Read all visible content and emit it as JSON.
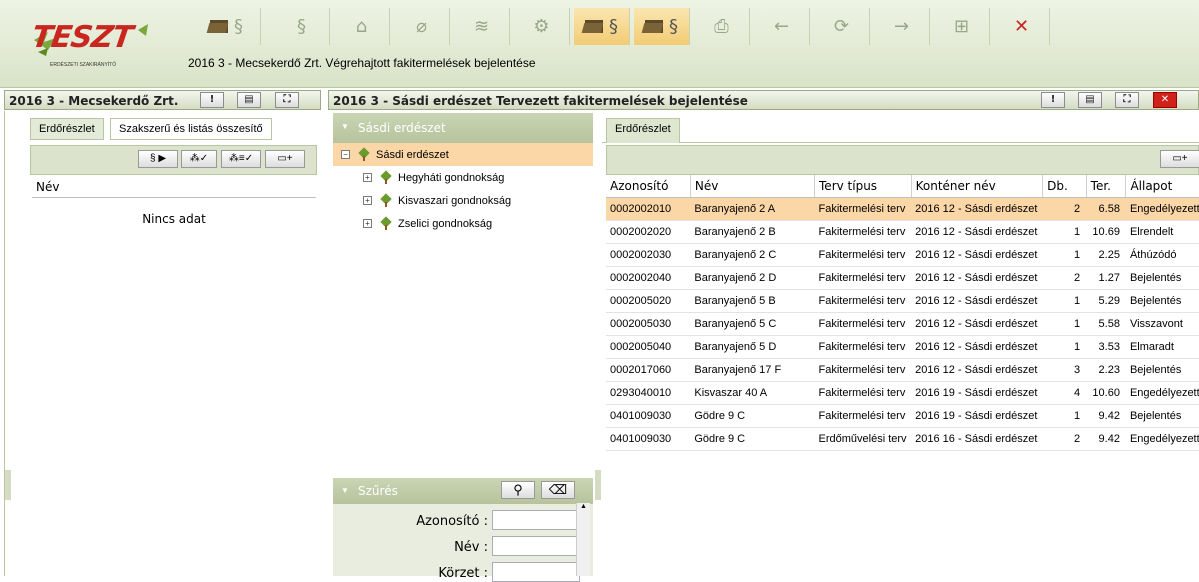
{
  "app": {
    "logo_text": "TESZT",
    "logo_subtitle": "ERDÉSZETI SZAKIRÁNYÍTÓ",
    "title": "2016 3 - Mecsekerdő Zrt. Végrehajtott fakitermelések bejelentése"
  },
  "toolbar": {
    "items": [
      {
        "glyph": "§",
        "folder": true,
        "active": false
      },
      {
        "glyph": "§",
        "folder": false,
        "active": false
      },
      {
        "glyph": "⌂",
        "folder": false,
        "active": false
      },
      {
        "glyph": "⌀",
        "folder": false,
        "active": false
      },
      {
        "glyph": "≋",
        "folder": false,
        "active": false
      },
      {
        "glyph": "⚙",
        "folder": false,
        "active": false
      },
      {
        "glyph": "§",
        "folder": true,
        "active": true
      },
      {
        "glyph": "§",
        "folder": true,
        "active": true
      },
      {
        "glyph": "⎙",
        "folder": false,
        "active": false
      },
      {
        "glyph": "←",
        "folder": false,
        "active": false
      },
      {
        "glyph": "⟳",
        "folder": false,
        "active": false
      },
      {
        "glyph": "→",
        "folder": false,
        "active": false
      },
      {
        "glyph": "⊞",
        "folder": false,
        "active": false
      },
      {
        "glyph": "✕",
        "folder": false,
        "active": false
      }
    ]
  },
  "left_panel": {
    "title": "2016 3 - Mecsekerdő Zrt.",
    "tabs": [
      "Erdőrészlet",
      "Szakszerű és listás összesítő"
    ],
    "column": "Név",
    "empty": "Nincs adat"
  },
  "right_panel": {
    "title": "2016 3 - Sásdi erdészet Tervezett fakitermelések bejelentése"
  },
  "tree": {
    "header": "Sásdi erdészet",
    "root": "Sásdi erdészet",
    "children": [
      "Hegyháti gondnokság",
      "Kisvaszari gondnokság",
      "Zselici gondnokság"
    ]
  },
  "filter": {
    "title": "Szűrés",
    "fields": [
      "Azonosító :",
      "Név :",
      "Körzet :"
    ]
  },
  "grid": {
    "tab": "Erdőrészlet",
    "columns": [
      "Azonosító",
      "Név",
      "Terv típus",
      "Konténer név",
      "Db.",
      "Ter.",
      "Állapot"
    ],
    "rows": [
      [
        "0002002010",
        "Baranyajenő 2 A",
        "Fakitermelési terv",
        "2016 12 - Sásdi erdészet",
        "2",
        "6.58",
        "Engedélyezett"
      ],
      [
        "0002002020",
        "Baranyajenő 2 B",
        "Fakitermelési terv",
        "2016 12 - Sásdi erdészet",
        "1",
        "10.69",
        "Elrendelt"
      ],
      [
        "0002002030",
        "Baranyajenő 2 C",
        "Fakitermelési terv",
        "2016 12 - Sásdi erdészet",
        "1",
        "2.25",
        "Áthúzódó"
      ],
      [
        "0002002040",
        "Baranyajenő 2 D",
        "Fakitermelési terv",
        "2016 12 - Sásdi erdészet",
        "2",
        "1.27",
        "Bejelentés"
      ],
      [
        "0002005020",
        "Baranyajenő 5 B",
        "Fakitermelési terv",
        "2016 12 - Sásdi erdészet",
        "1",
        "5.29",
        "Bejelentés"
      ],
      [
        "0002005030",
        "Baranyajenő 5 C",
        "Fakitermelési terv",
        "2016 12 - Sásdi erdészet",
        "1",
        "5.58",
        "Visszavont"
      ],
      [
        "0002005040",
        "Baranyajenő 5 D",
        "Fakitermelési terv",
        "2016 12 - Sásdi erdészet",
        "1",
        "3.53",
        "Elmaradt"
      ],
      [
        "0002017060",
        "Baranyajenő 17 F",
        "Fakitermelési terv",
        "2016 12 - Sásdi erdészet",
        "3",
        "2.23",
        "Bejelentés"
      ],
      [
        "0293040010",
        "Kisvaszar 40 A",
        "Fakitermelési terv",
        "2016 19 - Sásdi erdészet",
        "4",
        "10.60",
        "Engedélyezett"
      ],
      [
        "0401009030",
        "Gödre 9 C",
        "Fakitermelési terv",
        "2016 19 - Sásdi erdészet",
        "1",
        "9.42",
        "Bejelentés"
      ],
      [
        "0401009030",
        "Gödre 9 C",
        "Erdőművelési terv",
        "2016 16 - Sásdi erdészet",
        "2",
        "9.42",
        "Engedélyezett"
      ]
    ]
  }
}
